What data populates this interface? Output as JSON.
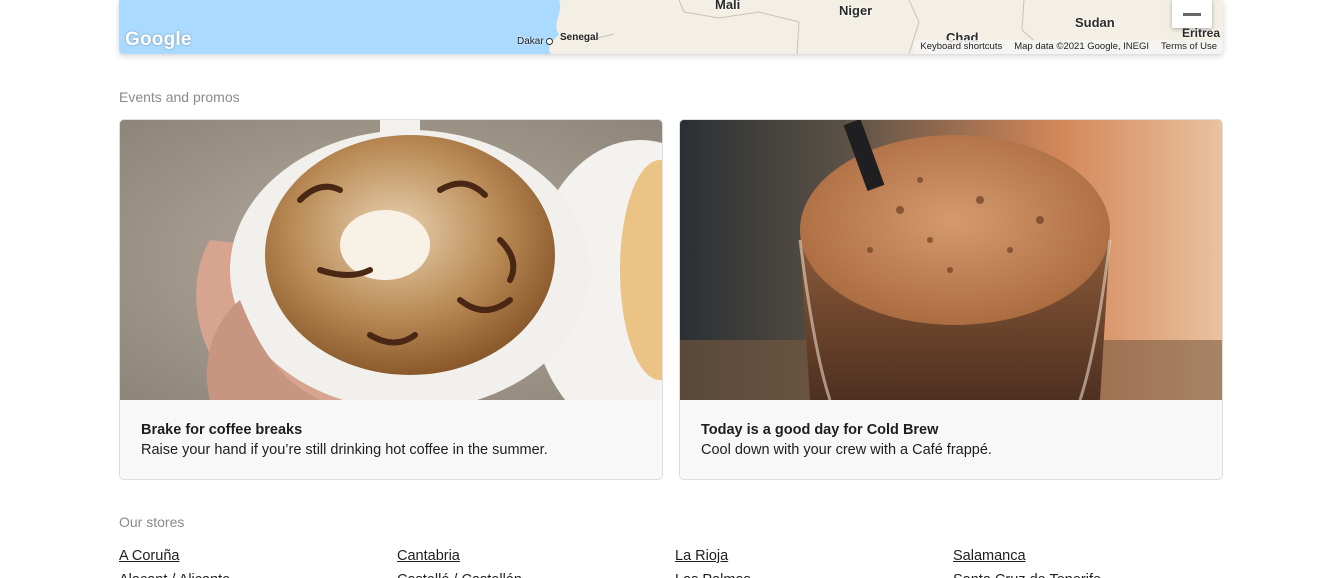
{
  "map": {
    "countries": [
      "Mali",
      "Niger",
      "Sudan",
      "Chad",
      "Eritrea",
      "Senegal"
    ],
    "cities": [
      "Dakar"
    ],
    "logo": "Google",
    "attribution": [
      "Keyboard shortcuts",
      "Map data ©2021 Google, INEGI",
      "Terms of Use"
    ],
    "zoom_out_icon": "minus-icon",
    "colors": {
      "water": "#aadaff",
      "land": "#f3efe4"
    }
  },
  "events": {
    "heading": "Events and promos",
    "cards": [
      {
        "image": "latte-art-cup-photo",
        "title": "Brake for coffee breaks",
        "description": "Raise your hand if you’re still drinking hot coffee in the summer."
      },
      {
        "image": "cold-brew-frappe-photo",
        "title": "Today is a good day for Cold Brew",
        "description": "Cool down with your crew with a Café frappé."
      }
    ]
  },
  "stores": {
    "heading": "Our stores",
    "items": [
      "A Coruña",
      "Cantabria",
      "La Rioja",
      "Salamanca",
      "Alacant / Alicante",
      "Castelló / Castellón",
      "Las Palmas",
      "Santa Cruz de Tenerife"
    ]
  }
}
